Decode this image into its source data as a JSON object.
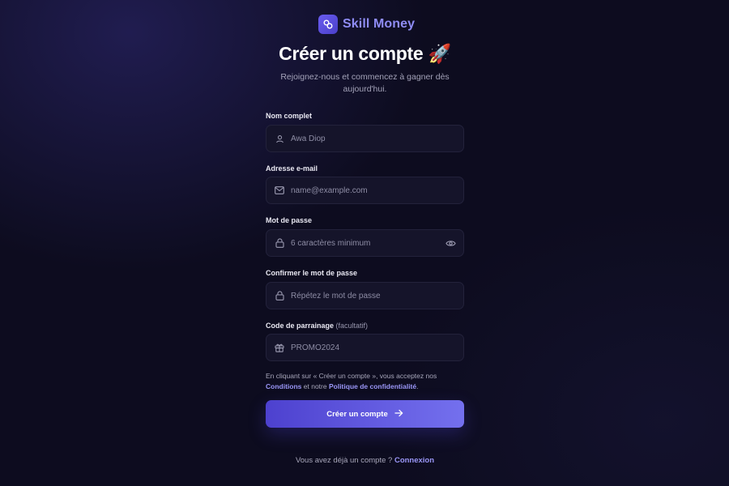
{
  "brand": {
    "name": "Skill Money"
  },
  "title": "Créer un compte",
  "title_emoji": "🚀",
  "subtitle": "Rejoignez-nous et commencez à gagner dès aujourd'hui.",
  "fields": [
    {
      "label": "Nom complet",
      "placeholder": "Awa Diop",
      "icon": "user-icon"
    },
    {
      "label": "Adresse e-mail",
      "placeholder": "name@example.com",
      "icon": "mail-icon"
    },
    {
      "label": "Mot de passe",
      "placeholder": "6 caractères minimum",
      "icon": "lock-icon",
      "toggle_icon": "eye-icon"
    },
    {
      "label": "Confirmer le mot de passe",
      "placeholder": "Répétez le mot de passe",
      "icon": "lock-icon"
    },
    {
      "label": "Code de parrainage",
      "label_hint": "(facultatif)",
      "placeholder": "PROMO2024",
      "icon": "gift-icon"
    }
  ],
  "terms": {
    "prefix": "En cliquant sur « Créer un compte », vous acceptez nos",
    "conditions_link": "Conditions",
    "middle": "et notre",
    "privacy_link": "Politique de confidentialité",
    "suffix": "."
  },
  "submit_label": "Créer un compte",
  "login_prompt": "Vous avez déjà un compte ?",
  "login_link": "Connexion",
  "colors": {
    "background": "#0d0c1f",
    "accent": "#6a5cf0",
    "link": "#9a96f7",
    "field_bg": "#15142a"
  }
}
